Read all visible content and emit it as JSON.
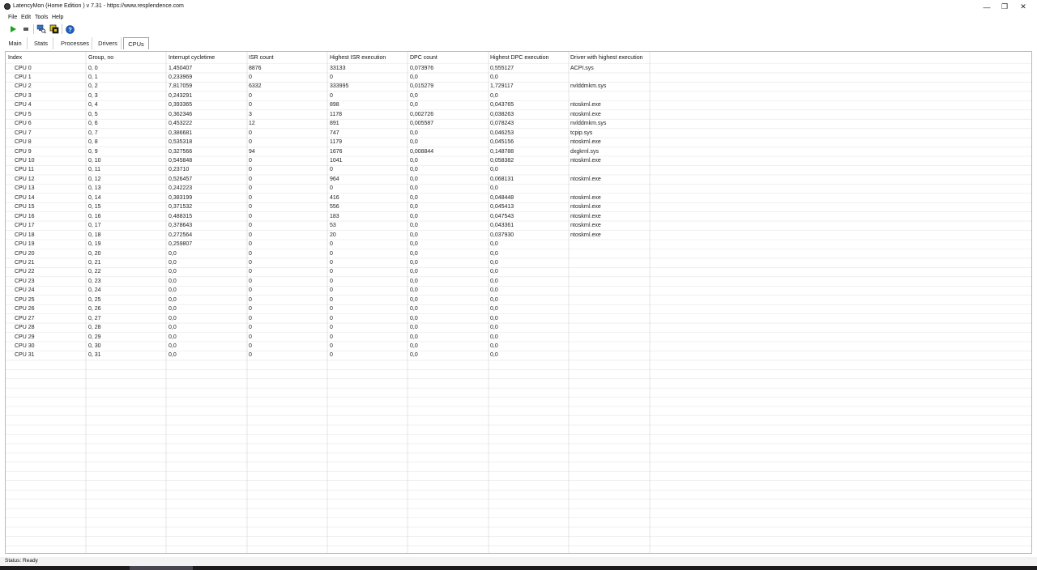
{
  "window": {
    "title": "LatencyMon  (Home Edition )  v 7.31 - https://www.resplendence.com"
  },
  "menu": [
    "File",
    "Edit",
    "Tools",
    "Help"
  ],
  "toolbar": {
    "buttons": [
      "play-icon",
      "stop-icon",
      "search-computer-icon",
      "cpu-icon",
      "help-icon"
    ]
  },
  "tabs": [
    "Main",
    "Stats",
    "Processes",
    "Drivers",
    "CPUs"
  ],
  "active_tab": "CPUs",
  "table": {
    "columns": [
      "Index",
      "Group, no",
      "Interrupt cycletime",
      "ISR count",
      "Highest ISR execution",
      "DPC count",
      "Highest DPC execution",
      "Driver with highest execution"
    ],
    "rows": [
      [
        "CPU 0",
        "0, 0",
        "1,450407",
        "8876",
        "33133",
        "0,073976",
        "0,555127",
        "ACPI.sys"
      ],
      [
        "CPU 1",
        "0, 1",
        "0,233969",
        "0",
        "0",
        "0,0",
        "0,0",
        ""
      ],
      [
        "CPU 2",
        "0, 2",
        "7,817059",
        "6332",
        "333995",
        "0,015279",
        "1,729117",
        "nvlddmkm.sys"
      ],
      [
        "CPU 3",
        "0, 3",
        "0,243291",
        "0",
        "0",
        "0,0",
        "0,0",
        ""
      ],
      [
        "CPU 4",
        "0, 4",
        "0,393365",
        "0",
        "898",
        "0,0",
        "0,043765",
        "ntoskrnl.exe"
      ],
      [
        "CPU 5",
        "0, 5",
        "0,362346",
        "3",
        "1178",
        "0,002726",
        "0,038263",
        "ntoskrnl.exe"
      ],
      [
        "CPU 6",
        "0, 6",
        "0,453222",
        "12",
        "891",
        "0,005587",
        "0,078243",
        "nvlddmkm.sys"
      ],
      [
        "CPU 7",
        "0, 7",
        "0,386681",
        "0",
        "747",
        "0,0",
        "0,046253",
        "tcpip.sys"
      ],
      [
        "CPU 8",
        "0, 8",
        "0,535318",
        "0",
        "1179",
        "0,0",
        "0,045156",
        "ntoskrnl.exe"
      ],
      [
        "CPU 9",
        "0, 9",
        "0,327566",
        "94",
        "1676",
        "0,008844",
        "0,148788",
        "dxgkrnl.sys"
      ],
      [
        "CPU 10",
        "0, 10",
        "0,545848",
        "0",
        "1041",
        "0,0",
        "0,058382",
        "ntoskrnl.exe"
      ],
      [
        "CPU 11",
        "0, 11",
        "0,23710",
        "0",
        "0",
        "0,0",
        "0,0",
        ""
      ],
      [
        "CPU 12",
        "0, 12",
        "0,526457",
        "0",
        "964",
        "0,0",
        "0,068131",
        "ntoskrnl.exe"
      ],
      [
        "CPU 13",
        "0, 13",
        "0,242223",
        "0",
        "0",
        "0,0",
        "0,0",
        ""
      ],
      [
        "CPU 14",
        "0, 14",
        "0,383199",
        "0",
        "416",
        "0,0",
        "0,048448",
        "ntoskrnl.exe"
      ],
      [
        "CPU 15",
        "0, 15",
        "0,371532",
        "0",
        "556",
        "0,0",
        "0,045413",
        "ntoskrnl.exe"
      ],
      [
        "CPU 16",
        "0, 16",
        "0,488315",
        "0",
        "183",
        "0,0",
        "0,047543",
        "ntoskrnl.exe"
      ],
      [
        "CPU 17",
        "0, 17",
        "0,378643",
        "0",
        "53",
        "0,0",
        "0,043361",
        "ntoskrnl.exe"
      ],
      [
        "CPU 18",
        "0, 18",
        "0,272564",
        "0",
        "20",
        "0,0",
        "0,037930",
        "ntoskrnl.exe"
      ],
      [
        "CPU 19",
        "0, 19",
        "0,259807",
        "0",
        "0",
        "0,0",
        "0,0",
        ""
      ],
      [
        "CPU 20",
        "0, 20",
        "0,0",
        "0",
        "0",
        "0,0",
        "0,0",
        ""
      ],
      [
        "CPU 21",
        "0, 21",
        "0,0",
        "0",
        "0",
        "0,0",
        "0,0",
        ""
      ],
      [
        "CPU 22",
        "0, 22",
        "0,0",
        "0",
        "0",
        "0,0",
        "0,0",
        ""
      ],
      [
        "CPU 23",
        "0, 23",
        "0,0",
        "0",
        "0",
        "0,0",
        "0,0",
        ""
      ],
      [
        "CPU 24",
        "0, 24",
        "0,0",
        "0",
        "0",
        "0,0",
        "0,0",
        ""
      ],
      [
        "CPU 25",
        "0, 25",
        "0,0",
        "0",
        "0",
        "0,0",
        "0,0",
        ""
      ],
      [
        "CPU 26",
        "0, 26",
        "0,0",
        "0",
        "0",
        "0,0",
        "0,0",
        ""
      ],
      [
        "CPU 27",
        "0, 27",
        "0,0",
        "0",
        "0",
        "0,0",
        "0,0",
        ""
      ],
      [
        "CPU 28",
        "0, 28",
        "0,0",
        "0",
        "0",
        "0,0",
        "0,0",
        ""
      ],
      [
        "CPU 29",
        "0, 29",
        "0,0",
        "0",
        "0",
        "0,0",
        "0,0",
        ""
      ],
      [
        "CPU 30",
        "0, 30",
        "0,0",
        "0",
        "0",
        "0,0",
        "0,0",
        ""
      ],
      [
        "CPU 31",
        "0, 31",
        "0,0",
        "0",
        "0",
        "0,0",
        "0,0",
        ""
      ]
    ]
  },
  "status": "Status: Ready",
  "colors": {
    "play": "#1aa31a",
    "stop": "#5a5a5a",
    "help": "#1f5fbf",
    "grid": "#e6e6e6",
    "column_divider": "#dcdcdc"
  }
}
